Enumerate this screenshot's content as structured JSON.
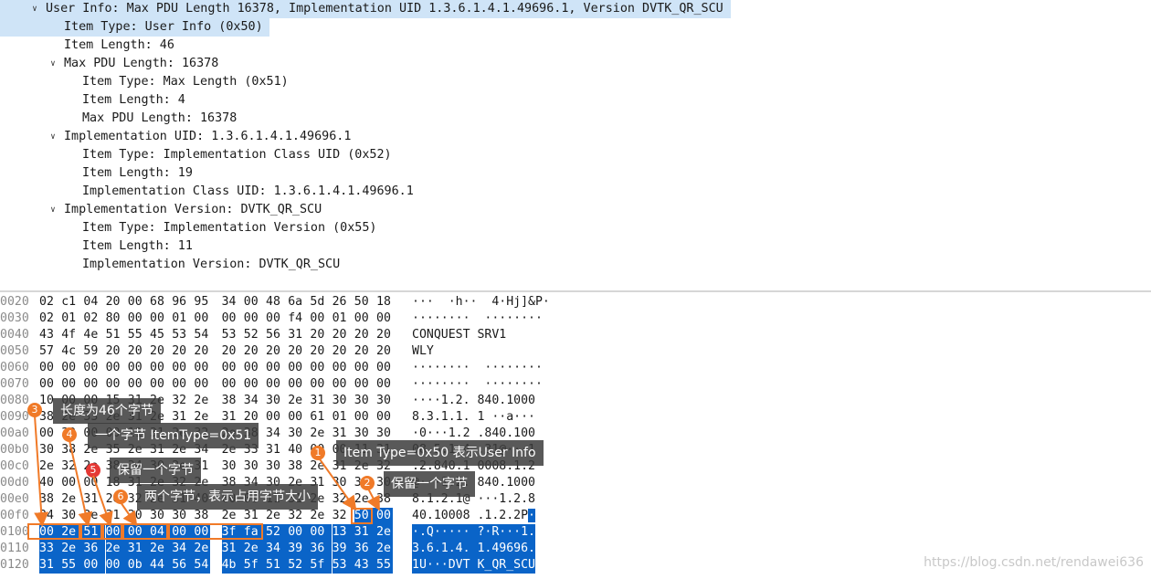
{
  "tree": [
    {
      "indent": 0,
      "toggle": "open",
      "text": "User Info: Max PDU Length 16378, Implementation UID 1.3.6.1.4.1.49696.1, Version DVTK_QR_SCU",
      "selected": true
    },
    {
      "indent": 1,
      "toggle": "",
      "text": "Item Type: User Info (0x50)",
      "selected": true
    },
    {
      "indent": 1,
      "toggle": "",
      "text": "Item Length: 46",
      "selected": false
    },
    {
      "indent": 1,
      "toggle": "open",
      "text": "Max PDU Length: 16378",
      "selected": false
    },
    {
      "indent": 2,
      "toggle": "",
      "text": "Item Type: Max Length (0x51)",
      "selected": false
    },
    {
      "indent": 2,
      "toggle": "",
      "text": "Item Length: 4",
      "selected": false
    },
    {
      "indent": 2,
      "toggle": "",
      "text": "Max PDU Length: 16378",
      "selected": false
    },
    {
      "indent": 1,
      "toggle": "open",
      "text": "Implementation UID: 1.3.6.1.4.1.49696.1",
      "selected": false
    },
    {
      "indent": 2,
      "toggle": "",
      "text": "Item Type: Implementation Class UID (0x52)",
      "selected": false
    },
    {
      "indent": 2,
      "toggle": "",
      "text": "Item Length: 19",
      "selected": false
    },
    {
      "indent": 2,
      "toggle": "",
      "text": "Implementation Class UID: 1.3.6.1.4.1.49696.1",
      "selected": false
    },
    {
      "indent": 1,
      "toggle": "open",
      "text": "Implementation Version: DVTK_QR_SCU",
      "selected": false
    },
    {
      "indent": 2,
      "toggle": "",
      "text": "Item Type: Implementation Version (0x55)",
      "selected": false
    },
    {
      "indent": 2,
      "toggle": "",
      "text": "Item Length: 11",
      "selected": false
    },
    {
      "indent": 2,
      "toggle": "",
      "text": "Implementation Version: DVTK_QR_SCU",
      "selected": false
    }
  ],
  "hex": [
    {
      "off": "0020",
      "bytes": [
        "02",
        "c1",
        "04",
        "20",
        "00",
        "68",
        "96",
        "95",
        "34",
        "00",
        "48",
        "6a",
        "5d",
        "26",
        "50",
        "18"
      ],
      "ascii": "···  ·h··  4·Hj]&P·",
      "hl": []
    },
    {
      "off": "0030",
      "bytes": [
        "02",
        "01",
        "02",
        "80",
        "00",
        "00",
        "01",
        "00",
        "00",
        "00",
        "00",
        "f4",
        "00",
        "01",
        "00",
        "00"
      ],
      "ascii": "········  ········",
      "hl": []
    },
    {
      "off": "0040",
      "bytes": [
        "43",
        "4f",
        "4e",
        "51",
        "55",
        "45",
        "53",
        "54",
        "53",
        "52",
        "56",
        "31",
        "20",
        "20",
        "20",
        "20"
      ],
      "ascii": "CONQUEST SRV1",
      "hl": []
    },
    {
      "off": "0050",
      "bytes": [
        "57",
        "4c",
        "59",
        "20",
        "20",
        "20",
        "20",
        "20",
        "20",
        "20",
        "20",
        "20",
        "20",
        "20",
        "20",
        "20"
      ],
      "ascii": "WLY",
      "hl": []
    },
    {
      "off": "0060",
      "bytes": [
        "00",
        "00",
        "00",
        "00",
        "00",
        "00",
        "00",
        "00",
        "00",
        "00",
        "00",
        "00",
        "00",
        "00",
        "00",
        "00"
      ],
      "ascii": "········  ········",
      "hl": []
    },
    {
      "off": "0070",
      "bytes": [
        "00",
        "00",
        "00",
        "00",
        "00",
        "00",
        "00",
        "00",
        "00",
        "00",
        "00",
        "00",
        "00",
        "00",
        "00",
        "00"
      ],
      "ascii": "········  ········",
      "hl": []
    },
    {
      "off": "0080",
      "bytes": [
        "10",
        "00",
        "00",
        "15",
        "31",
        "2e",
        "32",
        "2e",
        "38",
        "34",
        "30",
        "2e",
        "31",
        "30",
        "30",
        "30"
      ],
      "ascii": "····1.2. 840.1000",
      "hl": []
    },
    {
      "off": "0090",
      "bytes": [
        "38",
        "2e",
        "33",
        "2e",
        "31",
        "2e",
        "31",
        "2e",
        "31",
        "20",
        "00",
        "00",
        "61",
        "01",
        "00",
        "00"
      ],
      "ascii": "8.3.1.1. 1 ··a···",
      "hl": []
    },
    {
      "off": "00a0",
      "bytes": [
        "00",
        "30",
        "00",
        "00",
        "11",
        "31",
        "2e",
        "32",
        "2e",
        "38",
        "34",
        "30",
        "2e",
        "31",
        "30",
        "30"
      ],
      "ascii": "·0···1.2 .840.100",
      "hl": []
    },
    {
      "off": "00b0",
      "bytes": [
        "30",
        "38",
        "2e",
        "35",
        "2e",
        "31",
        "2e",
        "34",
        "2e",
        "33",
        "31",
        "40",
        "00",
        "00",
        "11",
        "31"
      ],
      "ascii": "08.5.1.4 .31@···1",
      "hl": []
    },
    {
      "off": "00c0",
      "bytes": [
        "2e",
        "32",
        "2e",
        "38",
        "34",
        "30",
        "2e",
        "31",
        "30",
        "30",
        "30",
        "38",
        "2e",
        "31",
        "2e",
        "32"
      ],
      "ascii": ".2.840.1 0008.1.2",
      "hl": []
    },
    {
      "off": "00d0",
      "bytes": [
        "40",
        "00",
        "00",
        "18",
        "31",
        "2e",
        "32",
        "2e",
        "38",
        "34",
        "30",
        "2e",
        "31",
        "30",
        "30",
        "30"
      ],
      "ascii": "@···1.2. 840.1000",
      "hl": []
    },
    {
      "off": "00e0",
      "bytes": [
        "38",
        "2e",
        "31",
        "2e",
        "32",
        "2e",
        "31",
        "40",
        "00",
        "00",
        "11",
        "31",
        "2e",
        "32",
        "2e",
        "38"
      ],
      "ascii": "8.1.2.1@ ···1.2.8",
      "hl": []
    },
    {
      "off": "00f0",
      "bytes": [
        "34",
        "30",
        "2e",
        "31",
        "30",
        "30",
        "30",
        "38",
        "2e",
        "31",
        "2e",
        "32",
        "2e",
        "32",
        "50",
        "00"
      ],
      "ascii": "40.10008 .1.2.2P·",
      "hl": [
        14,
        15
      ],
      "ascii_hl_from": 15
    },
    {
      "off": "0100",
      "bytes": [
        "00",
        "2e",
        "51",
        "00",
        "00",
        "04",
        "00",
        "00",
        "3f",
        "fa",
        "52",
        "00",
        "00",
        "13",
        "31",
        "2e"
      ],
      "ascii": "·.Q····· ?·R···1.",
      "hl": [
        0,
        1,
        2,
        3,
        4,
        5,
        6,
        7,
        8,
        9,
        10,
        11,
        12,
        13,
        14,
        15
      ],
      "ascii_hl_from": 0
    },
    {
      "off": "0110",
      "bytes": [
        "33",
        "2e",
        "36",
        "2e",
        "31",
        "2e",
        "34",
        "2e",
        "31",
        "2e",
        "34",
        "39",
        "36",
        "39",
        "36",
        "2e"
      ],
      "ascii": "3.6.1.4. 1.49696.",
      "hl": [
        0,
        1,
        2,
        3,
        4,
        5,
        6,
        7,
        8,
        9,
        10,
        11,
        12,
        13,
        14,
        15
      ],
      "ascii_hl_from": 0
    },
    {
      "off": "0120",
      "bytes": [
        "31",
        "55",
        "00",
        "00",
        "0b",
        "44",
        "56",
        "54",
        "4b",
        "5f",
        "51",
        "52",
        "5f",
        "53",
        "43",
        "55"
      ],
      "ascii": "1U···DVT K_QR_SCU",
      "hl": [
        0,
        1,
        2,
        3,
        4,
        5,
        6,
        7,
        8,
        9,
        10,
        11,
        12,
        13,
        14,
        15
      ],
      "ascii_hl_from": 0
    }
  ],
  "annotations": [
    {
      "num": "1",
      "text": "Item Type=0x50 表示User Info"
    },
    {
      "num": "2",
      "text": "保留一个字节"
    },
    {
      "num": "3",
      "text": "长度为46个字节"
    },
    {
      "num": "4",
      "text": "一个字节 ItemType=0x51"
    },
    {
      "num": "5",
      "text": "保留一个字节"
    },
    {
      "num": "6",
      "text": "两个字节，表示占用字节大小"
    }
  ],
  "watermark": "https://blog.csdn.net/rendawei636",
  "colors": {
    "selection": "#cfe4f7",
    "byte_highlight": "#0a64c8",
    "annotation_box": "#f07a28",
    "badge_red": "#e53935"
  }
}
